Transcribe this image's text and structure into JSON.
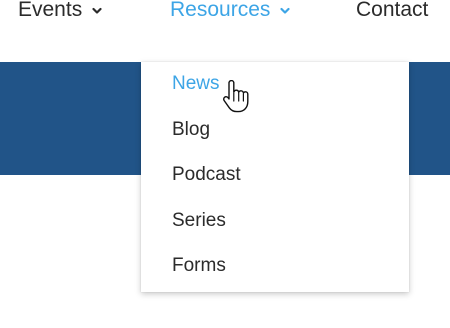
{
  "nav": {
    "items": [
      {
        "label": "Events",
        "has_dropdown": true,
        "active": false
      },
      {
        "label": "Resources",
        "has_dropdown": true,
        "active": true
      },
      {
        "label": "Contact",
        "has_dropdown": false,
        "active": false
      }
    ]
  },
  "dropdown": {
    "items": [
      {
        "label": "News",
        "hovered": true
      },
      {
        "label": "Blog",
        "hovered": false
      },
      {
        "label": "Podcast",
        "hovered": false
      },
      {
        "label": "Series",
        "hovered": false
      },
      {
        "label": "Forms",
        "hovered": false
      }
    ]
  },
  "colors": {
    "accent": "#3da5e6",
    "banner": "#215488",
    "text": "#2b2b2b"
  },
  "icons": {
    "chevron": "chevron-down-icon",
    "cursor": "hand-pointer-cursor-icon"
  }
}
